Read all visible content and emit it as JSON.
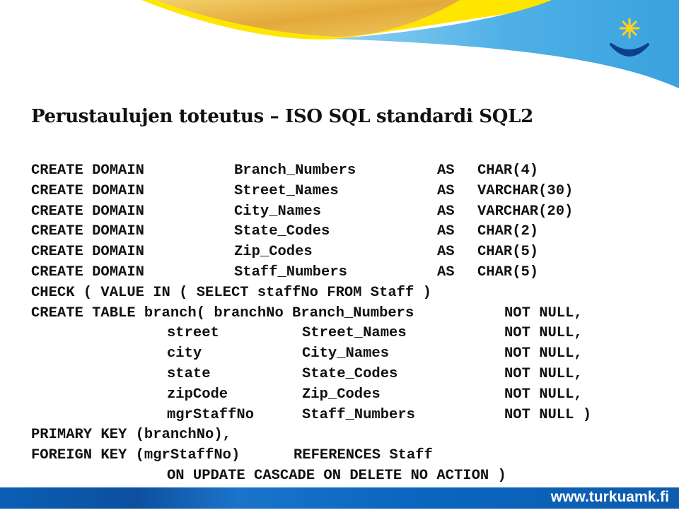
{
  "slide": {
    "title": "Perustaulujen toteutus – ISO SQL standardi SQL2",
    "footer_url": "www.turkuamk.fi",
    "colors": {
      "banner_yellow": "#ffe600",
      "banner_gold": "#e8b84a",
      "banner_blue": "#5ab4e6",
      "logo_sun": "#ffd21a",
      "logo_smile": "#0c3f8c",
      "footer_blue": "#0a5fb5"
    },
    "domains": [
      {
        "kw": "CREATE DOMAIN",
        "name": "Branch_Numbers",
        "as": "AS",
        "type": "CHAR(4)"
      },
      {
        "kw": "CREATE DOMAIN",
        "name": "Street_Names",
        "as": "AS",
        "type": "VARCHAR(30)"
      },
      {
        "kw": "CREATE DOMAIN",
        "name": "City_Names",
        "as": "AS",
        "type": "VARCHAR(20)"
      },
      {
        "kw": "CREATE DOMAIN",
        "name": "State_Codes",
        "as": "AS",
        "type": "CHAR(2)"
      },
      {
        "kw": "CREATE DOMAIN",
        "name": "Zip_Codes",
        "as": "AS",
        "type": "CHAR(5)"
      },
      {
        "kw": "CREATE DOMAIN",
        "name": "Staff_Numbers",
        "as": "AS",
        "type": "CHAR(5)"
      }
    ],
    "check_line": "CHECK ( VALUE IN ( SELECT staffNo FROM Staff )",
    "create_table": {
      "prefix": "CREATE TABLE branch( branchNo Branch_Numbers",
      "prefix_constraint": "NOT NULL,",
      "columns": [
        {
          "name": "street",
          "type": "Street_Names",
          "constraint": "NOT NULL,"
        },
        {
          "name": "city",
          "type": "City_Names",
          "constraint": "NOT NULL,"
        },
        {
          "name": "state",
          "type": "State_Codes",
          "constraint": "NOT NULL,"
        },
        {
          "name": "zipCode",
          "type": "Zip_Codes",
          "constraint": "NOT NULL,"
        },
        {
          "name": "mgrStaffNo",
          "type": "Staff_Numbers",
          "constraint": "NOT NULL )"
        }
      ]
    },
    "primary_key": "PRIMARY KEY (branchNo),",
    "foreign_key": "FOREIGN KEY (mgrStaffNo)",
    "references": "REFERENCES Staff",
    "on_clause": "ON UPDATE CASCADE ON DELETE NO ACTION )"
  }
}
